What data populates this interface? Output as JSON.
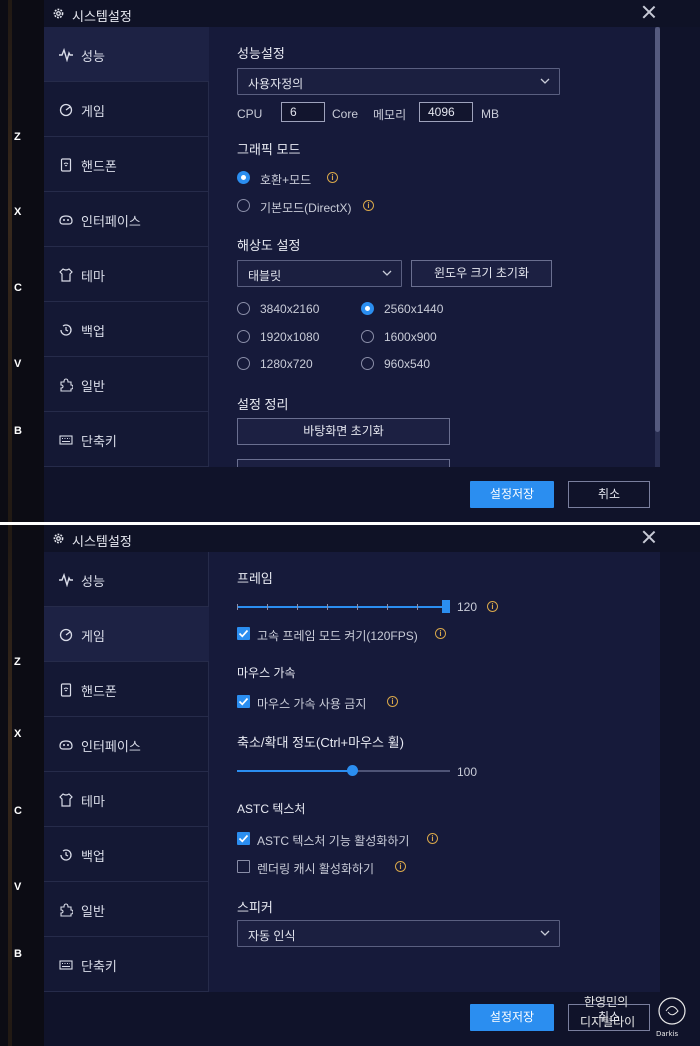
{
  "app_title": "시스템설정",
  "hotkeys": [
    "Z",
    "X",
    "C",
    "V",
    "B"
  ],
  "sidebar": [
    {
      "label": "성능",
      "icon": "pulse-icon"
    },
    {
      "label": "게임",
      "icon": "gamepad-icon"
    },
    {
      "label": "핸드폰",
      "icon": "phone-icon"
    },
    {
      "label": "인터페이스",
      "icon": "interface-icon"
    },
    {
      "label": "테마",
      "icon": "shirt-icon"
    },
    {
      "label": "백업",
      "icon": "history-icon"
    },
    {
      "label": "일반",
      "icon": "puzzle-icon"
    },
    {
      "label": "단축키",
      "icon": "keyboard-icon"
    }
  ],
  "footer": {
    "save": "설정저장",
    "cancel": "취소"
  },
  "performance": {
    "title": "성능설정",
    "preset": "사용자정의",
    "cpu_label": "CPU",
    "cpu_value": "6",
    "core_label": "Core",
    "memory_label": "메모리",
    "memory_value": "4096",
    "mb_label": "MB",
    "graphics_title": "그래픽 모드",
    "graphics_modes": [
      "호환+모드",
      "기본모드(DirectX)"
    ],
    "graphics_selected": 0,
    "resolution_title": "해상도 설정",
    "resolution_preset": "태블릿",
    "reset_window_button": "윈도우 크기 초기화",
    "resolutions": [
      "3840x2160",
      "2560x1440",
      "1920x1080",
      "1600x900",
      "1280x720",
      "960x540"
    ],
    "resolution_selected": 1,
    "cleanup_title": "설정 정리",
    "reset_desktop_button": "바탕화면 초기화"
  },
  "game": {
    "frame_title": "프레임",
    "frame_value": "120",
    "frame_fraction": 1.0,
    "high_frame_label": "고속 프레임 모드 켜기(120FPS)",
    "high_frame_checked": true,
    "mouse_title": "마우스 가속",
    "mouse_accel_label": "마우스 가속 사용 금지",
    "mouse_accel_checked": true,
    "zoom_title": "축소/확대 정도(Ctrl+마우스 휠)",
    "zoom_value": "100",
    "zoom_fraction": 0.54,
    "astc_title": "ASTC 텍스처",
    "astc_label": "ASTC 텍스처 기능 활성화하기",
    "astc_checked": true,
    "render_cache_label": "렌더링 캐시 활성화하기",
    "render_cache_checked": false,
    "speaker_title": "스피커",
    "speaker_value": "자동 인식"
  },
  "watermark": {
    "line1": "한영민의",
    "line2": "디지털라이",
    "logo_text": "Darkis"
  },
  "colors": {
    "accent": "#2b8ef0",
    "info": "#d8a74a",
    "panel": "#161a3a",
    "sidebar": "#141834",
    "window": "#10132a"
  }
}
